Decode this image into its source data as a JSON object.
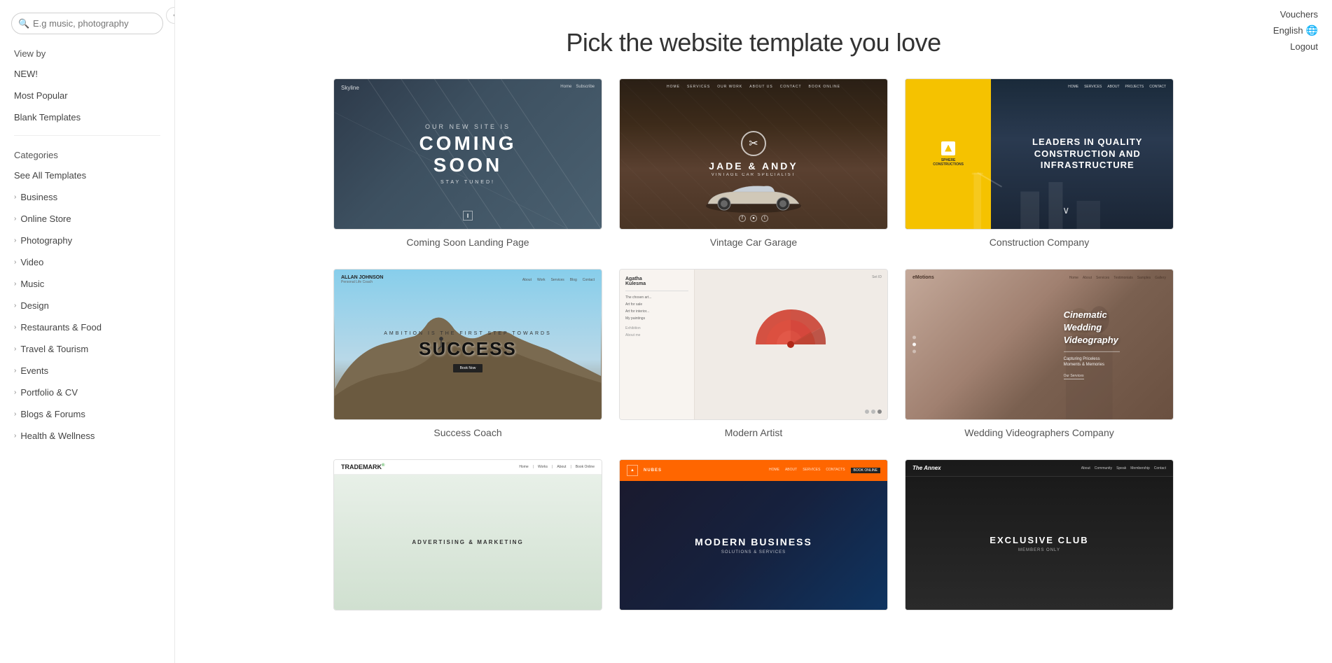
{
  "sidebar": {
    "collapse_label": "‹",
    "search": {
      "placeholder": "E.g music, photography"
    },
    "view_by_label": "View by",
    "items": [
      {
        "id": "new",
        "label": "NEW!"
      },
      {
        "id": "most-popular",
        "label": "Most Popular"
      },
      {
        "id": "blank-templates",
        "label": "Blank Templates"
      }
    ],
    "categories_label": "Categories",
    "category_items": [
      {
        "id": "see-all",
        "label": "See All Templates",
        "active": true
      },
      {
        "id": "business",
        "label": "Business"
      },
      {
        "id": "online-store",
        "label": "Online Store"
      },
      {
        "id": "photography",
        "label": "Photography"
      },
      {
        "id": "video",
        "label": "Video"
      },
      {
        "id": "music",
        "label": "Music"
      },
      {
        "id": "design",
        "label": "Design"
      },
      {
        "id": "restaurants-food",
        "label": "Restaurants & Food"
      },
      {
        "id": "travel-tourism",
        "label": "Travel & Tourism"
      },
      {
        "id": "events",
        "label": "Events"
      },
      {
        "id": "portfolio-cv",
        "label": "Portfolio & CV"
      },
      {
        "id": "blogs-forums",
        "label": "Blogs & Forums"
      },
      {
        "id": "health-wellness",
        "label": "Health & Wellness"
      }
    ]
  },
  "top_right": {
    "vouchers": "Vouchers",
    "language": "English",
    "logout": "Logout"
  },
  "page": {
    "title": "Pick the website template you love"
  },
  "templates": [
    {
      "id": "coming-soon",
      "label": "Coming Soon Landing Page",
      "type": "coming-soon"
    },
    {
      "id": "vintage-car",
      "label": "Vintage Car Garage",
      "type": "vintage-car"
    },
    {
      "id": "construction",
      "label": "Construction Company",
      "type": "construction"
    },
    {
      "id": "success-coach",
      "label": "Success Coach",
      "type": "success-coach"
    },
    {
      "id": "modern-artist",
      "label": "Modern Artist",
      "type": "modern-artist"
    },
    {
      "id": "wedding-video",
      "label": "Wedding Videographers Company",
      "type": "wedding-video"
    },
    {
      "id": "trademark",
      "label": "",
      "type": "trademark"
    },
    {
      "id": "orange-biz",
      "label": "",
      "type": "orange"
    },
    {
      "id": "dark-theme",
      "label": "",
      "type": "dark"
    }
  ]
}
